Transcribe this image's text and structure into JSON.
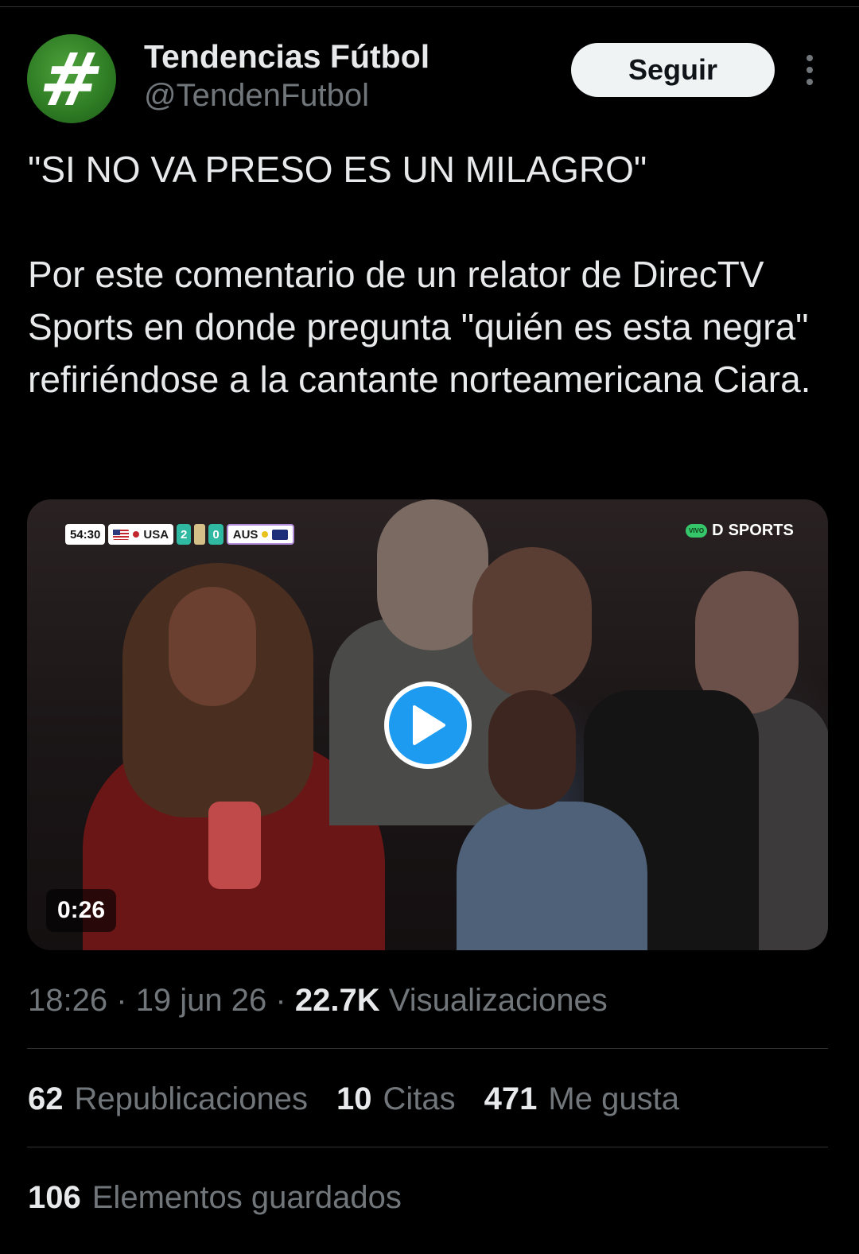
{
  "author": {
    "display_name": "Tendencias Fútbol",
    "handle": "@TendenFutbol",
    "avatar_glyph": "#"
  },
  "follow_button": {
    "label": "Seguir"
  },
  "tweet": {
    "paragraphs": [
      "\"SI NO VA PRESO ES UN MILAGRO\"",
      "Por este comentario de un relator de DirecTV Sports en donde pregunta \"quién es esta negra\" refiriéndose a la cantante norteamericana Ciara."
    ]
  },
  "media": {
    "type": "video",
    "duration": "0:26",
    "scorebug": {
      "clock": "54:30",
      "home_team": "USA",
      "home_score": "2",
      "away_score": "0",
      "away_team": "AUS"
    },
    "channel": {
      "badge": "VIVO",
      "name": "SPORTS"
    }
  },
  "meta": {
    "time": "18:26",
    "separator": "·",
    "date": "19 jun 26",
    "views_count": "22.7K",
    "views_label": "Visualizaciones"
  },
  "stats": {
    "reposts": {
      "count": "62",
      "label": "Republicaciones"
    },
    "quotes": {
      "count": "10",
      "label": "Citas"
    },
    "likes": {
      "count": "471",
      "label": "Me gusta"
    },
    "bookmarks": {
      "count": "106",
      "label": "Elementos guardados"
    }
  },
  "colors": {
    "background": "#000000",
    "text_primary": "#e7e9ea",
    "text_secondary": "#71767b",
    "divider": "#2f3336",
    "accent_blue": "#1d9bf0",
    "avatar_green": "#2d7a23"
  },
  "icons": {
    "more": "more-vertical-icon",
    "play": "play-icon"
  }
}
